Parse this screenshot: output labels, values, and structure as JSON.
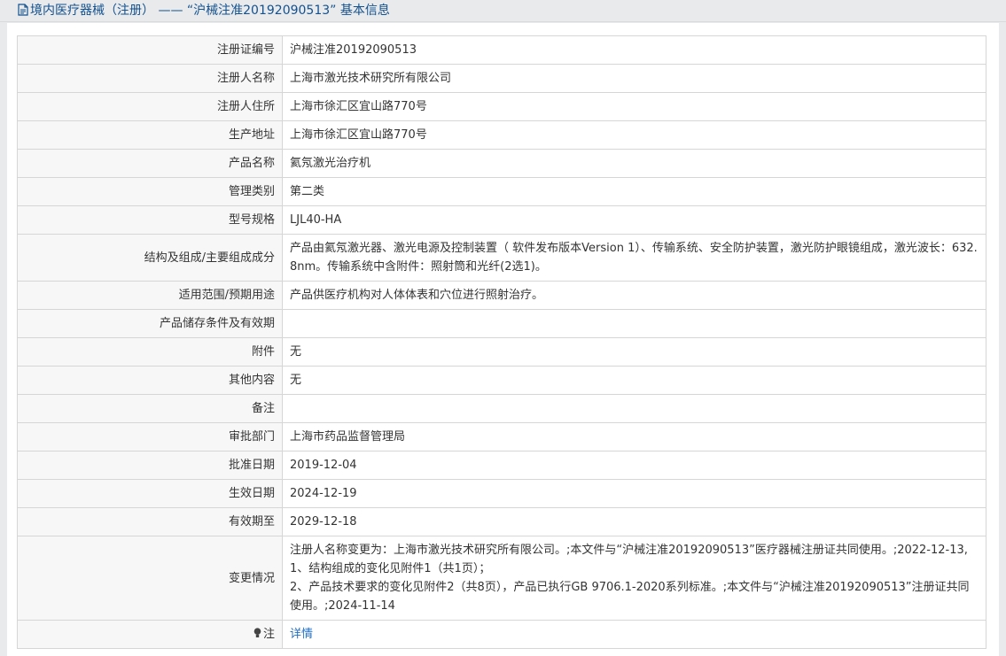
{
  "header": {
    "title": "境内医疗器械（注册） —— “沪械注准20192090513” 基本信息",
    "icon": "document-icon"
  },
  "rows": [
    {
      "label": "注册证编号",
      "value": "沪械注准20192090513"
    },
    {
      "label": "注册人名称",
      "value": "上海市激光技术研究所有限公司"
    },
    {
      "label": "注册人住所",
      "value": "上海市徐汇区宜山路770号"
    },
    {
      "label": "生产地址",
      "value": "上海市徐汇区宜山路770号"
    },
    {
      "label": "产品名称",
      "value": "氦氖激光治疗机"
    },
    {
      "label": "管理类别",
      "value": "第二类"
    },
    {
      "label": "型号规格",
      "value": "LJL40-HA"
    },
    {
      "label": "结构及组成/主要组成成分",
      "value": "产品由氦氖激光器、激光电源及控制装置（ 软件发布版本Version 1）、传输系统、安全防护装置，激光防护眼镜组成，激光波长：632.8nm。传输系统中含附件：照射筒和光纤(2选1)。"
    },
    {
      "label": "适用范围/预期用途",
      "value": "产品供医疗机构对人体体表和穴位进行照射治疗。"
    },
    {
      "label": "产品储存条件及有效期",
      "value": ""
    },
    {
      "label": "附件",
      "value": "无"
    },
    {
      "label": "其他内容",
      "value": "无"
    },
    {
      "label": "备注",
      "value": ""
    },
    {
      "label": "审批部门",
      "value": "上海市药品监督管理局"
    },
    {
      "label": "批准日期",
      "value": "2019-12-04"
    },
    {
      "label": "生效日期",
      "value": "2024-12-19"
    },
    {
      "label": "有效期至",
      "value": "2029-12-18"
    }
  ],
  "change": {
    "label": "变更情况",
    "line1": "注册人名称变更为：上海市激光技术研究所有限公司。;本文件与“沪械注准20192090513”医疗器械注册证共同使用。;2022-12-13,",
    "line2": "1、结构组成的变化见附件1（共1页）；",
    "line3": "2、产品技术要求的变化见附件2（共8页），产品已执行GB 9706.1-2020系列标准。;本文件与“沪械注准20192090513”注册证共同使用。;2024-11-14"
  },
  "note": {
    "label": "注",
    "icon": "lightbulb-icon",
    "link": "详情"
  }
}
